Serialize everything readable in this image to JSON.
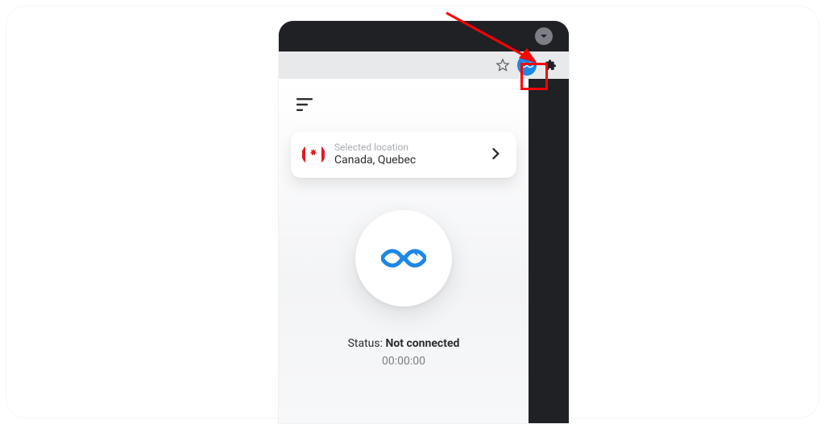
{
  "titlebar": {
    "dropdown_icon": "chevron-down"
  },
  "urlbar": {
    "star_icon": "star",
    "extension_name": "vpn-extension",
    "extensions_icon": "puzzle"
  },
  "popup": {
    "menu_icon": "sort-lines",
    "location": {
      "label": "Selected location",
      "value": "Canada, Quebec",
      "flag": "canada",
      "chevron": "chevron-right"
    },
    "connect": {
      "icon": "infinity",
      "brand_color": "#1d87e4"
    },
    "status": {
      "label": "Status: ",
      "value": "Not connected"
    },
    "timer": "00:00:00"
  },
  "annotation": {
    "arrow_color": "#ff0000",
    "highlight_color": "#ff0000"
  }
}
